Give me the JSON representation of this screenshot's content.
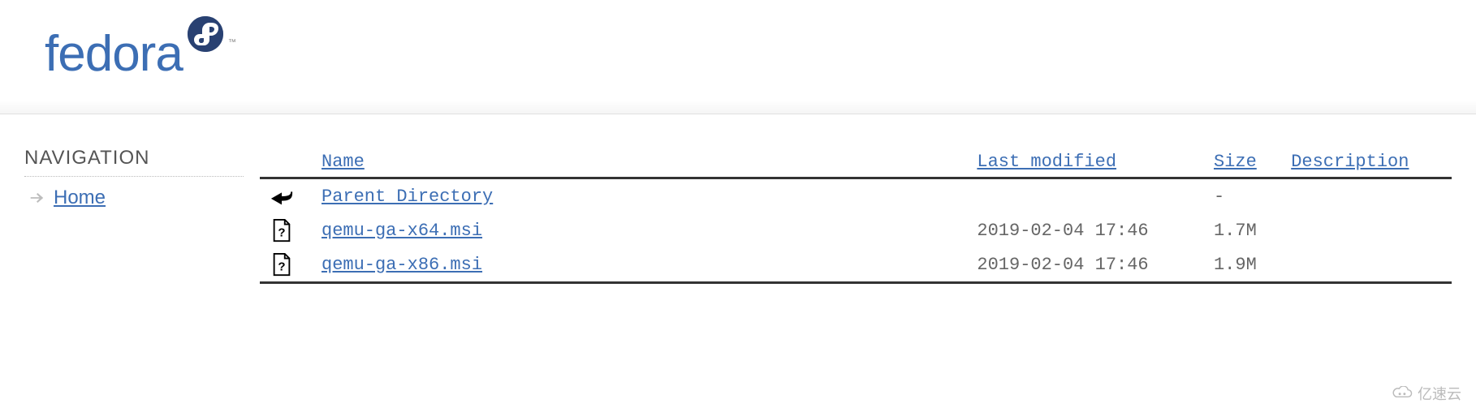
{
  "logo_text": "fedora",
  "trademark": "™",
  "sidebar": {
    "title": "NAVIGATION",
    "home_label": "Home"
  },
  "columns": {
    "name": "Name",
    "last_modified": "Last modified",
    "size": "Size",
    "description": "Description"
  },
  "parent": {
    "label": "Parent Directory",
    "size": "-"
  },
  "files": [
    {
      "name": "qemu-ga-x64.msi",
      "modified": "2019-02-04 17:46",
      "size": "1.7M",
      "description": ""
    },
    {
      "name": "qemu-ga-x86.msi",
      "modified": "2019-02-04 17:46",
      "size": "1.9M",
      "description": ""
    }
  ],
  "watermark": "亿速云"
}
